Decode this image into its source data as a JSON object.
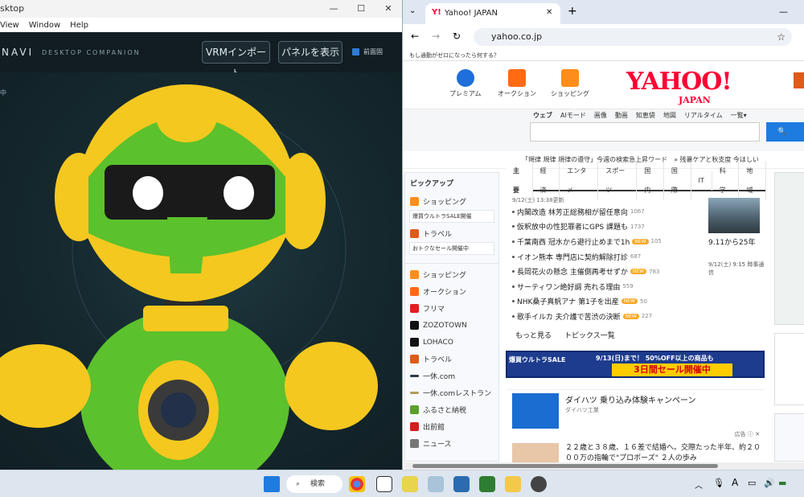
{
  "left_app": {
    "title": "sktop",
    "menu": [
      "View",
      "Window",
      "Help"
    ],
    "brand": "NAVI",
    "brand_sub": "DESKTOP COMPANION",
    "btn_import": "VRMインポート",
    "btn_panel": "パネルを表示",
    "checkbox_label": "前面固",
    "stage_note": "中"
  },
  "browser": {
    "tab_title": "Yahoo! JAPAN",
    "url": "yahoo.co.jp",
    "bookmark": "もし通勤がゼロになったら何する？",
    "services": [
      "プレミアム",
      "オークション",
      "ショッピング"
    ],
    "logo": "YAHOO!",
    "logo_sub": "JAPAN",
    "search_tabs": [
      "ウェブ",
      "AIモード",
      "画像",
      "動画",
      "知恵袋",
      "地図",
      "リアルタイム",
      "一覧▾"
    ],
    "trend": "「規律 規律 規律の遵守」今週の検索急上昇ワード　» 残暑ケアと秋支度 今ほしい"
  },
  "pickup": {
    "heading": "ピックアップ",
    "shopping": "ショッピング",
    "shopping_sub": "爆買ウルトラSALE開催",
    "travel": "トラベル",
    "travel_sub": "おトクなセール開催中",
    "services": [
      "ショッピング",
      "オークション",
      "フリマ",
      "ZOZOTOWN",
      "LOHACO",
      "トラベル",
      "一休.com",
      "一休.comレストラン",
      "ふるさと納税",
      "出前館",
      "ニュース"
    ]
  },
  "news": {
    "tabs": [
      "主要",
      "経済",
      "エンタメ",
      "スポーツ",
      "国内",
      "国際",
      "IT",
      "科学",
      "地域"
    ],
    "updated": "9/12(土) 13:38更新",
    "items": [
      {
        "text": "内閣改造 林芳正総務相が留任意向",
        "count": "1067",
        "new": ""
      },
      {
        "text": "仮釈放中の性犯罪者にGPS 課題も",
        "count": "1737",
        "new": ""
      },
      {
        "text": "千葉南西 冠水から避行止めまで1h",
        "count": "105",
        "new": "NEW"
      },
      {
        "text": "イオン熊本 専門店に契約解除打診",
        "count": "687",
        "new": ""
      },
      {
        "text": "長岡花火の懸念 主催側再考せずか",
        "count": "783",
        "new": "NEW"
      },
      {
        "text": "サーティワン絶好調 売れる理由",
        "count": "559",
        "new": ""
      },
      {
        "text": "NHK桑子真帆アナ 第1子を出産",
        "count": "50",
        "new": "NEW"
      },
      {
        "text": "歌手イルカ 夫介護で苦渋の決断",
        "count": "227",
        "new": "NEW"
      }
    ],
    "photo_caption": "9.11から25年",
    "photo_meta": "9/12(土) 9:15 時事通信",
    "more": "もっと見る",
    "topics": "トピックス一覧",
    "banner_left": "爆買ウルトラSALE",
    "banner_date": "9/13(日)まで！ 50%OFF以上の商品も",
    "banner_sale": "3日間セール開催中",
    "ad_title": "ダイハツ 乗り込み体験キャンペーン",
    "ad_sponsor": "ダイハツ工業",
    "ad_tag": "広告 ⓘ ✕",
    "ad2_text": "２２歳と３８歳、１６差で結婚へ。交際たった半年、約２０００万の指輪で\"プロポーズ\" ２人の歩み"
  },
  "taskbar": {
    "search": "検索"
  }
}
